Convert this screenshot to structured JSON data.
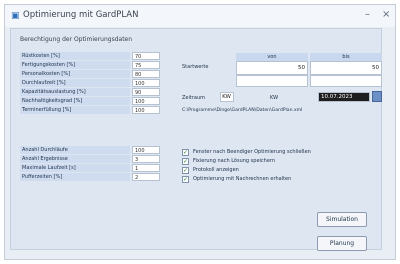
{
  "window": {
    "title": "Optimierung mit GardPLAN",
    "app_icon": "app-icon",
    "minimize": "–",
    "close": "×"
  },
  "group": {
    "title": "Berechtigung der Optimierungsdaten"
  },
  "params_top": [
    {
      "label": "Rüstkosten [%]",
      "value": "70"
    },
    {
      "label": "Fertigungskosten [%]",
      "value": "75"
    },
    {
      "label": "Personalkosten [%]",
      "value": "80"
    },
    {
      "label": "Durchlaufzeit [%]",
      "value": "100"
    },
    {
      "label": "Kapazitätsauslastung [%]",
      "value": "90"
    },
    {
      "label": "Nachhaltigkeitsgrad [%]",
      "value": "100"
    },
    {
      "label": "Terminerfüllung [%]",
      "value": "100"
    }
  ],
  "params_bottom": [
    {
      "label": "Anzahl Durchläufe",
      "value": "100"
    },
    {
      "label": "Anzahl Ergebnisse",
      "value": "3"
    },
    {
      "label": "Maximale Laufzeit [s]",
      "value": "1"
    },
    {
      "label": "Pufferzeiten [%]",
      "value": "2"
    }
  ],
  "grid": {
    "col1": "von",
    "col2": "bis",
    "row_label": "Startwerte",
    "val1": "50",
    "val2": "50"
  },
  "zeitraum": {
    "label": "Zeitraum",
    "from": "KW",
    "to": "KW",
    "value": "10.07.2023",
    "path": "C:\\Programme\\Dingo\\GardPLAN\\Daten\\GardPlan.xml"
  },
  "checks": [
    {
      "label": "Fenster nach Beendiger Optimierung schließen",
      "checked": true
    },
    {
      "label": "Fixierung nach Lösung speichern",
      "checked": true
    },
    {
      "label": "Protokoll anzeigen",
      "checked": true
    },
    {
      "label": "Optimierung mit Nachrechnen erhalten",
      "checked": true
    }
  ],
  "buttons": {
    "simulate": "Simulation",
    "optimize": "Planung"
  }
}
